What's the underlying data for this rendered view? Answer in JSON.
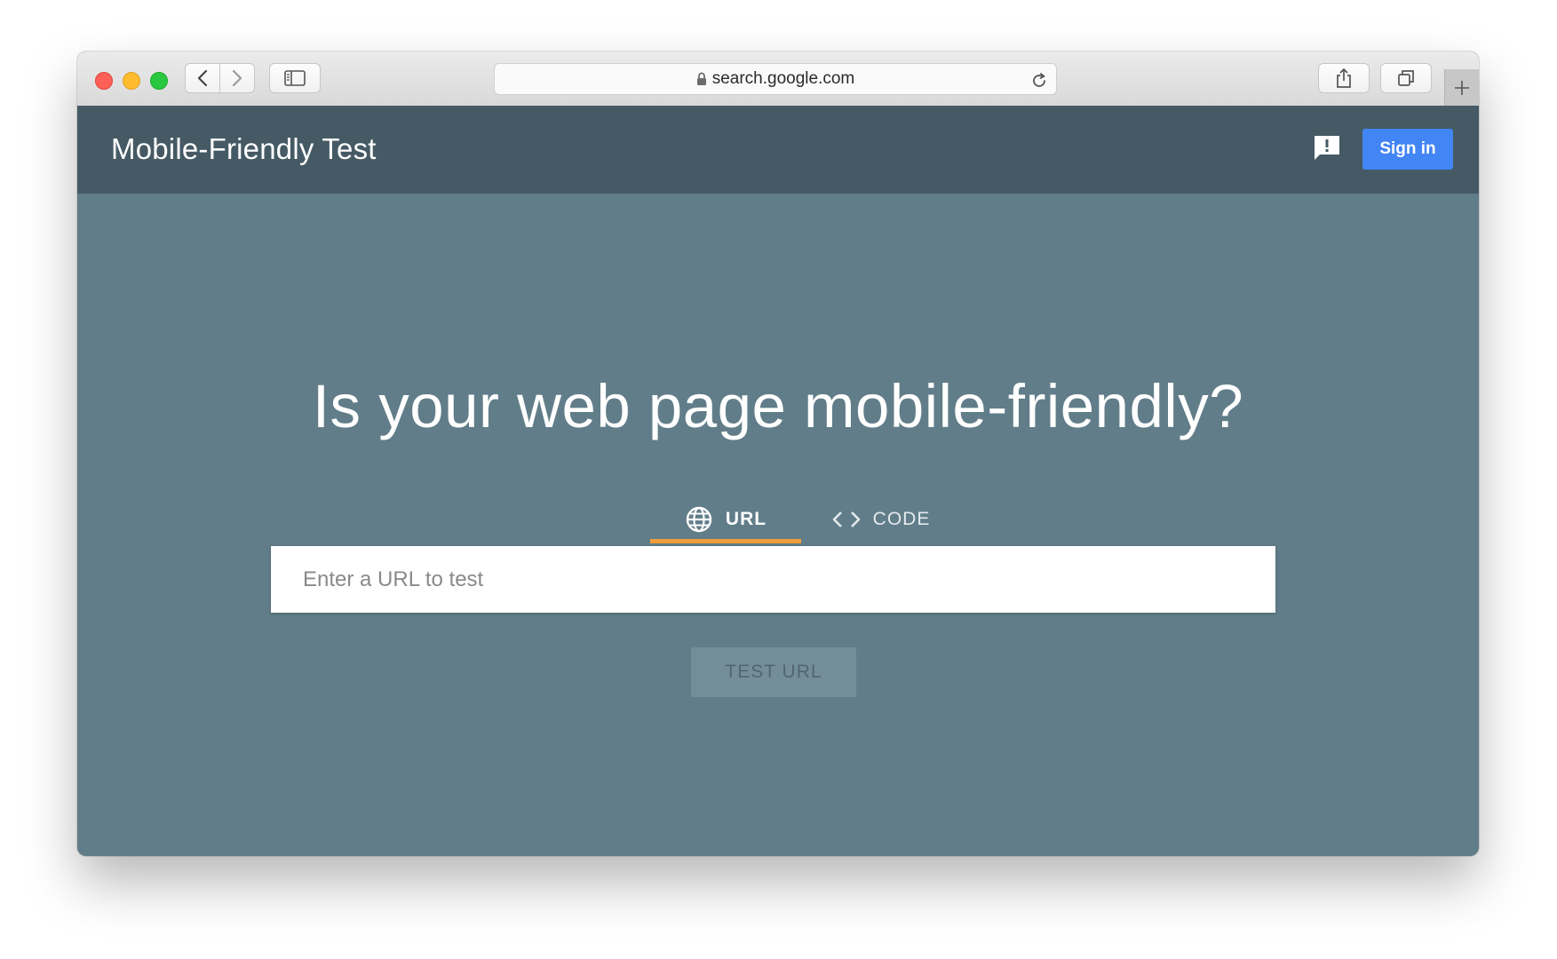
{
  "browser": {
    "address": "search.google.com",
    "icons": {
      "back": "chevron-left-icon",
      "forward": "chevron-right-icon",
      "sidebar": "sidebar-icon",
      "lock": "lock-icon",
      "reload": "reload-icon",
      "share": "share-icon",
      "tabs": "tabs-icon",
      "new_tab": "plus-icon"
    }
  },
  "header": {
    "title": "Mobile-Friendly Test",
    "feedback_icon": "feedback-icon",
    "signin_label": "Sign in"
  },
  "main": {
    "headline": "Is your web page mobile-friendly?",
    "tabs": [
      {
        "label": "URL",
        "icon": "globe-icon",
        "active": true
      },
      {
        "label": "CODE",
        "icon": "code-icon",
        "active": false
      }
    ],
    "input": {
      "placeholder": "Enter a URL to test",
      "value": ""
    },
    "test_button_label": "TEST URL"
  },
  "colors": {
    "header_bg": "#455a64",
    "page_bg": "#617d89",
    "accent_tab": "#f29d3d",
    "signin_bg": "#4285f4"
  }
}
